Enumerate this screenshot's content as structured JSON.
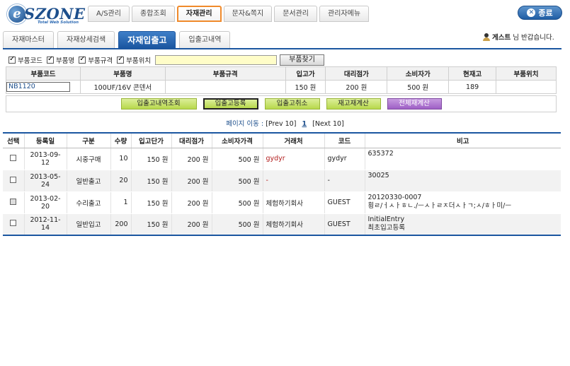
{
  "logo": {
    "text": "SZONE",
    "letter": "e",
    "sub": "Total Web Solution"
  },
  "topnav": [
    "A/S관리",
    "종합조회",
    "자재관리",
    "문자&쪽지",
    "문서관리",
    "관리자메뉴"
  ],
  "exit_label": "종료",
  "greeting": {
    "name": "게스트",
    "suffix": "님 반갑습니다."
  },
  "subtabs": [
    "자재마스터",
    "자재상세검색",
    "자재입출고",
    "입출고내역"
  ],
  "search": {
    "checkboxes": [
      "부품코드",
      "부품명",
      "부품규격",
      "부품위치"
    ],
    "input_value": "",
    "button": "부품찾기"
  },
  "part_table": {
    "headers": [
      "부품코드",
      "부품명",
      "부품규격",
      "입고가",
      "대리점가",
      "소비자가",
      "현재고",
      "부품위치"
    ],
    "row": {
      "code": "NB1120",
      "name": "100UF/16V 콘덴서",
      "spec": "",
      "in_price": "150 원",
      "dealer_price": "200 원",
      "consumer_price": "500 원",
      "stock": "189",
      "location": ""
    }
  },
  "actions": [
    "입출고내역조회",
    "입출고등록",
    "입출고취소",
    "재고재계산",
    "전체재계산"
  ],
  "pager": {
    "label": "페이지 이동 :",
    "prev": "[Prev 10]",
    "current": "1",
    "next": "[Next 10]"
  },
  "history": {
    "headers": [
      "선택",
      "등록일",
      "구분",
      "수량",
      "입고단가",
      "대리점가",
      "소비자가격",
      "거래처",
      "코드",
      "비고"
    ],
    "rows": [
      {
        "date": "2013-09-12",
        "type": "시중구매",
        "qty": "10",
        "unit": "150 원",
        "dealer": "200 원",
        "consumer": "500 원",
        "vendor": "gydyr",
        "code": "gydyr",
        "memo1": "635372",
        "memo2": ""
      },
      {
        "date": "2013-05-24",
        "type": "일반출고",
        "qty": "20",
        "unit": "150 원",
        "dealer": "200 원",
        "consumer": "500 원",
        "vendor": "-",
        "code": "-",
        "memo1": "30025",
        "memo2": ""
      },
      {
        "date": "2013-02-20",
        "type": "수리출고",
        "qty": "1",
        "unit": "150 원",
        "dealer": "200 원",
        "consumer": "500 원",
        "vendor": "체험하기회사",
        "code": "GUEST",
        "memo1": "20120330-0007",
        "memo2": "횡ㄹ/ㅓㅅㅏㅎㄴ./ㅡㅅㅏㄹㅈ더ㅅㅏㄱ;ㅅ/ㅎㅏ미/ㅡ"
      },
      {
        "date": "2012-11-14",
        "type": "일반입고",
        "qty": "200",
        "unit": "150 원",
        "dealer": "200 원",
        "consumer": "500 원",
        "vendor": "체험하기회사",
        "code": "GUEST",
        "memo1": "InitialEntry",
        "memo2": "최초입고등록"
      }
    ]
  },
  "colors": {
    "brand_blue": "#1b56a0",
    "active_orange": "#f08a2b",
    "action_green": "#b7d84b",
    "action_purple": "#9e5fc5",
    "vendor_red": "#b32020"
  }
}
